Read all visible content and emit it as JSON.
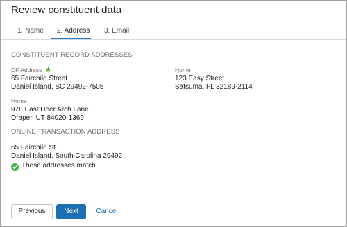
{
  "dialog": {
    "title": "Review constituent data"
  },
  "tabs": [
    {
      "label": "1. Name",
      "active": false
    },
    {
      "label": "2. Address",
      "active": true
    },
    {
      "label": "3. Email",
      "active": false
    }
  ],
  "constituent_addresses": {
    "header": "CONSTITUENT RECORD ADDRESSES",
    "entries": [
      {
        "label": "DF Address",
        "preferred_icon": "star-icon",
        "line1": "65 Fairchild Street",
        "line2": "Daniel Island, SC 29492-7505"
      },
      {
        "label": "Home",
        "line1": "123 Easy Street",
        "line2": "Satsuma, FL 32189-2114"
      },
      {
        "label": "Home",
        "line1": "978 East Deer Arch Lane",
        "line2": "Draper, UT 84020-1369"
      }
    ]
  },
  "online_transaction": {
    "header": "ONLINE TRANSACTION ADDRESS",
    "line1": "65 Fairchild St.",
    "line2": "Daniel Island, South Carolina 29492",
    "match_icon": "check-circle-icon",
    "match_text": "These addresses match"
  },
  "footer": {
    "previous_label": "Previous",
    "next_label": "Next",
    "cancel_label": "Cancel"
  },
  "colors": {
    "accent": "#1c6fb5",
    "tab_underline": "#2b7bc0",
    "star": "#5ba829",
    "match_check": "#4caf50"
  }
}
